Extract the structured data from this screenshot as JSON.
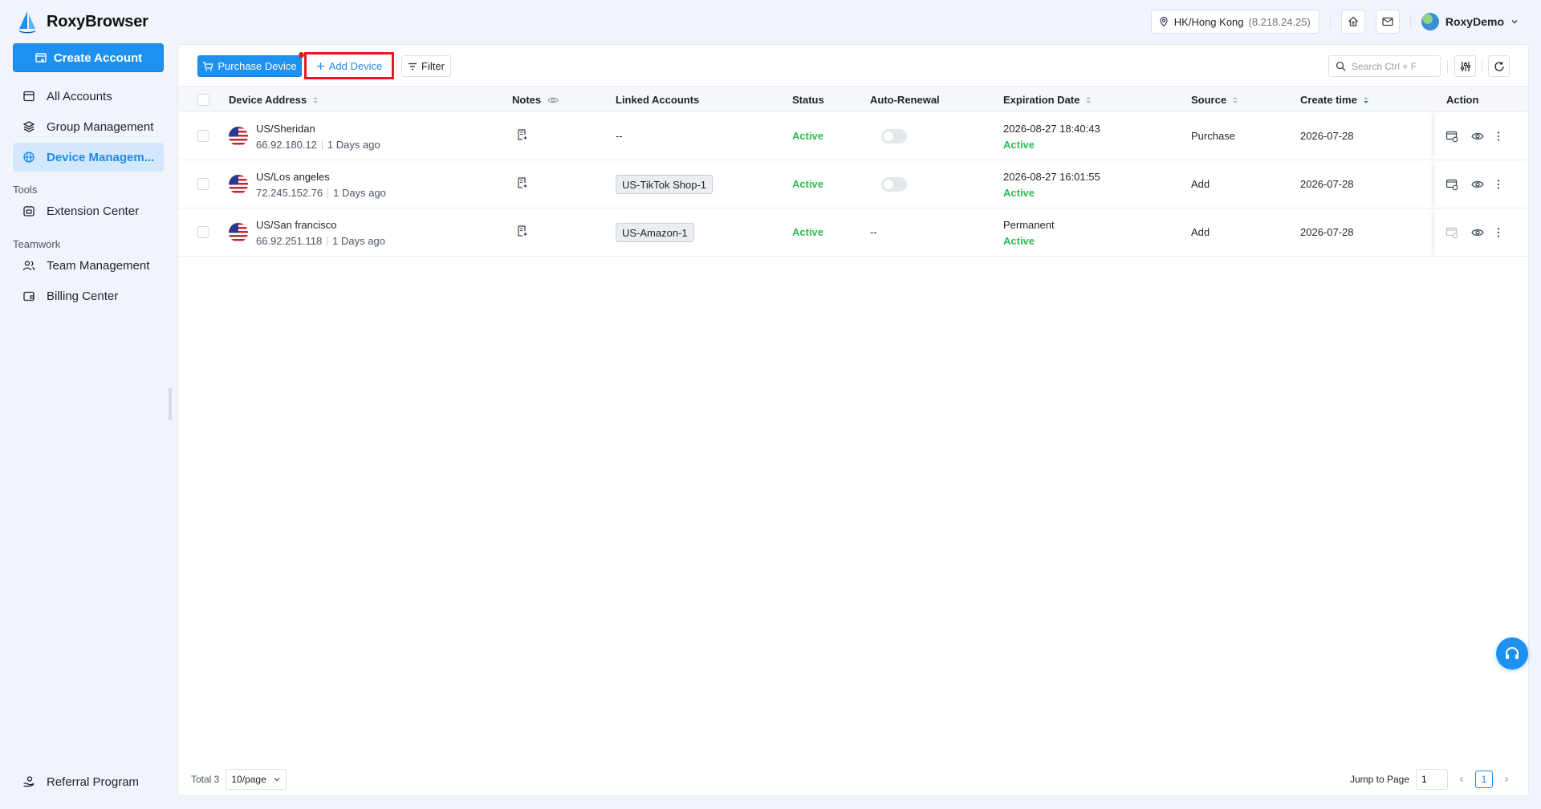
{
  "app": {
    "name": "RoxyBrowser"
  },
  "header": {
    "location": "HK/Hong Kong",
    "ip": "(8.218.24.25)",
    "user": "RoxyDemo"
  },
  "sidebar": {
    "create_label": "Create Account",
    "items": [
      {
        "label": "All Accounts",
        "icon": "accounts-icon"
      },
      {
        "label": "Group Management",
        "icon": "layers-icon"
      },
      {
        "label": "Device Managem...",
        "icon": "globe-icon",
        "active": true
      }
    ],
    "tools_heading": "Tools",
    "tools": [
      {
        "label": "Extension Center",
        "icon": "extension-icon"
      }
    ],
    "teamwork_heading": "Teamwork",
    "teamwork": [
      {
        "label": "Team Management",
        "icon": "team-icon"
      },
      {
        "label": "Billing Center",
        "icon": "wallet-icon"
      }
    ],
    "referral_label": "Referral Program"
  },
  "toolbar": {
    "purchase_label": "Purchase Device",
    "add_label": "Add Device",
    "filter_label": "Filter",
    "search_placeholder": "Search Ctrl + F"
  },
  "table": {
    "columns": {
      "address": "Device Address",
      "notes": "Notes",
      "linked": "Linked Accounts",
      "status": "Status",
      "renewal": "Auto-Renewal",
      "expiration": "Expiration Date",
      "source": "Source",
      "created": "Create time",
      "action": "Action"
    },
    "rows": [
      {
        "location": "US/Sheridan",
        "ip": "66.92.180.12",
        "age": "1 Days ago",
        "linked": "--",
        "status": "Active",
        "renewal": "toggle",
        "expiration": "2026-08-27 18:40:43",
        "exp_status": "Active",
        "source": "Purchase",
        "created": "2026-07-28"
      },
      {
        "location": "US/Los angeles",
        "ip": "72.245.152.76",
        "age": "1 Days ago",
        "linked": "US-TikTok Shop-1",
        "status": "Active",
        "renewal": "toggle",
        "expiration": "2026-08-27 16:01:55",
        "exp_status": "Active",
        "source": "Add",
        "created": "2026-07-28"
      },
      {
        "location": "US/San francisco",
        "ip": "66.92.251.118",
        "age": "1 Days ago",
        "linked": "US-Amazon-1",
        "status": "Active",
        "renewal": "--",
        "expiration": "Permanent",
        "exp_status": "Active",
        "source": "Add",
        "created": "2026-07-28"
      }
    ]
  },
  "pagination": {
    "total": "Total 3",
    "page_size": "10/page",
    "jump_label": "Jump to Page",
    "jump_value": "1",
    "current_page": "1"
  },
  "colors": {
    "accent": "#1e90f0",
    "active": "#2dbb55",
    "highlight": "#e11b22"
  }
}
